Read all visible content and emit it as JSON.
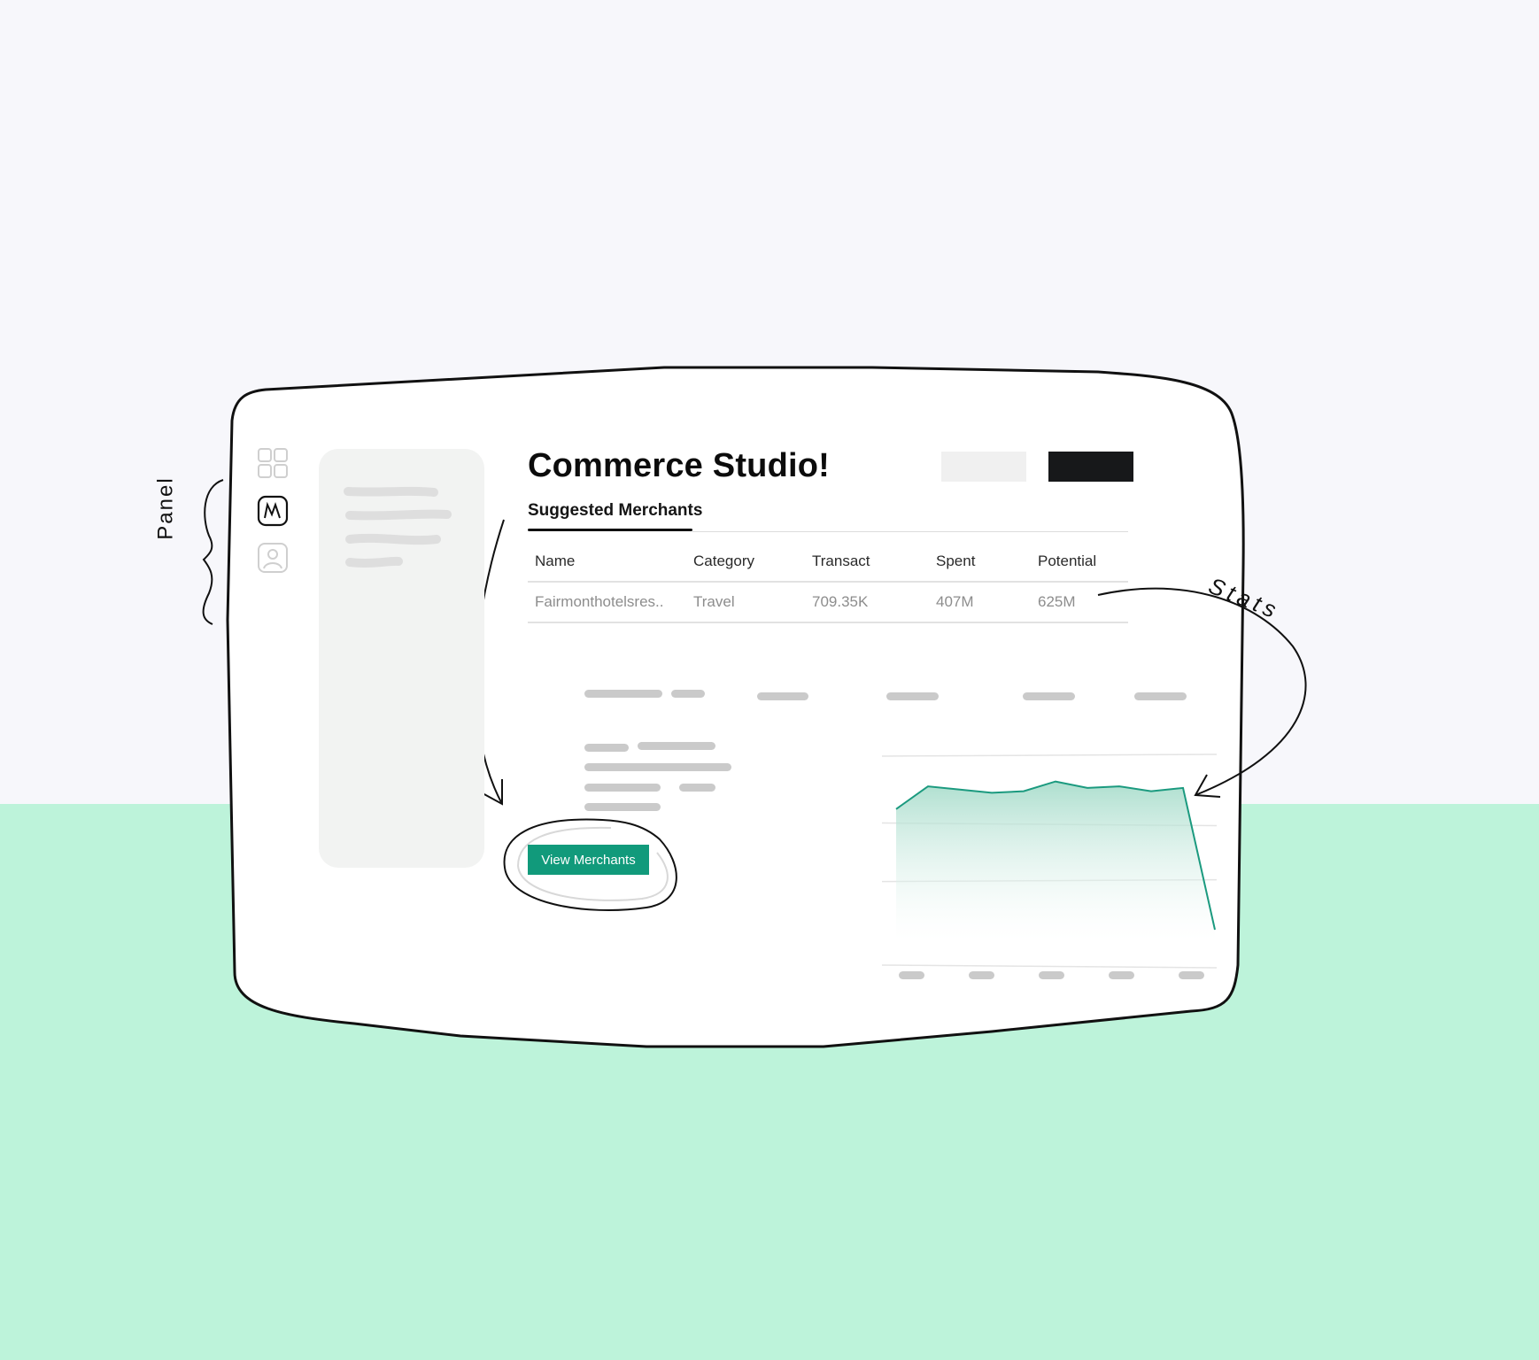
{
  "header": {
    "title": "Commerce Studio!"
  },
  "tabs": {
    "active_label": "Suggested Merchants"
  },
  "table": {
    "columns": [
      "Name",
      "Category",
      "Transact",
      "Spent",
      "Potential"
    ],
    "rows": [
      [
        "Fairmonthotelsres..",
        "Travel",
        "709.35K",
        "407M",
        "625M"
      ]
    ]
  },
  "cta": {
    "label": "View Merchants"
  },
  "annotations": {
    "panel": "Panel",
    "stats": "Stats"
  },
  "rail": {
    "icons": [
      "grid-icon",
      "merchant-logo-icon",
      "profile-icon"
    ]
  },
  "chart_data": {
    "type": "area",
    "x": [
      1,
      2,
      3,
      4,
      5,
      6,
      7,
      8,
      9,
      10,
      11
    ],
    "series": [
      {
        "values": [
          0.74,
          0.88,
          0.86,
          0.84,
          0.85,
          0.91,
          0.87,
          0.88,
          0.85,
          0.87,
          0.0
        ]
      }
    ],
    "ylim": [
      0,
      1
    ],
    "grid": true,
    "colors": {
      "line": "#1b9a7f",
      "fill": "#bfe6da"
    }
  },
  "colors": {
    "accent": "#119a7b",
    "background_top": "#f7f7fb",
    "background_bottom": "#bdf3da"
  }
}
